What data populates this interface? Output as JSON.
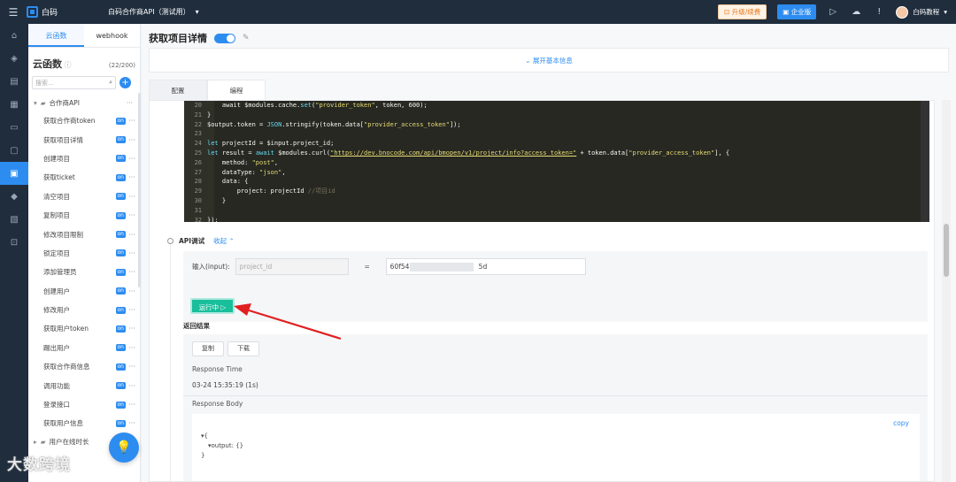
{
  "topbar": {
    "logo_text": "白码",
    "project_name": "白码合作商API（测试用）",
    "upgrade_label": "升级/续费",
    "enterprise_label": "企业版",
    "user_name": "白码教程"
  },
  "sidebar": {
    "tabs": [
      "云函数",
      "webhook"
    ],
    "title": "云函数",
    "count": "(22/200)",
    "search_placeholder": "搜索...",
    "folder_name": "合作商API",
    "items": [
      {
        "label": "获取合作商token",
        "badge": "on"
      },
      {
        "label": "获取项目详情",
        "badge": "on"
      },
      {
        "label": "创建项目",
        "badge": "on"
      },
      {
        "label": "获取ticket",
        "badge": "on"
      },
      {
        "label": "清空项目",
        "badge": "on"
      },
      {
        "label": "复制项目",
        "badge": "on"
      },
      {
        "label": "修改项目限制",
        "badge": "on"
      },
      {
        "label": "锁定项目",
        "badge": "on"
      },
      {
        "label": "添加管理员",
        "badge": "on"
      },
      {
        "label": "创建用户",
        "badge": "on"
      },
      {
        "label": "修改用户",
        "badge": "on"
      },
      {
        "label": "获取用户token",
        "badge": "on"
      },
      {
        "label": "踢出用户",
        "badge": "on"
      },
      {
        "label": "获取合作商信息",
        "badge": "on"
      },
      {
        "label": "调用功能",
        "badge": "on"
      },
      {
        "label": "登录接口",
        "badge": "on"
      },
      {
        "label": "获取用户信息",
        "badge": "on"
      }
    ],
    "folder2_name": "用户在线时长"
  },
  "main": {
    "page_title": "获取项目详情",
    "expand_label": "展开基本信息",
    "tabs": [
      "配置",
      "编程"
    ],
    "code_lines": [
      {
        "no": "20",
        "html": "    await $modules.cache.<span class=\"kw\">set</span>(<span class=\"str\">\"provider_token\"</span>, token, 600);"
      },
      {
        "no": "21",
        "html": "}"
      },
      {
        "no": "22",
        "html": "$output.token = <span class=\"kw\">JSON</span>.stringify(token.data[<span class=\"str\">\"provider_access_token\"</span>]);"
      },
      {
        "no": "23",
        "html": ""
      },
      {
        "no": "24",
        "html": "<span class=\"kw\">let</span> projectId = $input.project_id;"
      },
      {
        "no": "25",
        "html": "<span class=\"kw\">let</span> result = <span class=\"kw\">await</span> $modules.curl(<span class=\"url\">\"https://dev.bnocode.com/api/bmopen/v1/project/info?access_token=\"</span> + token.data[<span class=\"str\">\"provider_access_token\"</span>], {"
      },
      {
        "no": "26",
        "html": "    method: <span class=\"str\">\"post\"</span>,"
      },
      {
        "no": "27",
        "html": "    dataType: <span class=\"str\">\"json\"</span>,"
      },
      {
        "no": "28",
        "html": "    data: {"
      },
      {
        "no": "29",
        "html": "        project: projectId <span class=\"cm\">//项目id</span>"
      },
      {
        "no": "30",
        "html": "    }"
      },
      {
        "no": "31",
        "html": ""
      },
      {
        "no": "32",
        "html": "});"
      }
    ],
    "api_test_label": "API调试",
    "collapse_label": "收起",
    "input_label": "输入(input):",
    "param_name": "project_id",
    "equals": "=",
    "param_value_prefix": "60f5480",
    "param_value_suffix": "5d",
    "run_label": "运行中",
    "result_title": "返回结果",
    "copy_button": "复制",
    "download_button": "下载",
    "response_time_label": "Response Time",
    "response_time_value": "03-24 15:35:19 (1s)",
    "response_body_label": "Response Body",
    "copy_link": "copy",
    "json_line1": "{",
    "json_line2": "output: {}",
    "json_line3": "}"
  },
  "watermark": "大数跨境",
  "colors": {
    "accent": "#2d8cf0",
    "run": "#19be9b",
    "arrow": "#e02020",
    "topbar": "#1f2d3d"
  }
}
